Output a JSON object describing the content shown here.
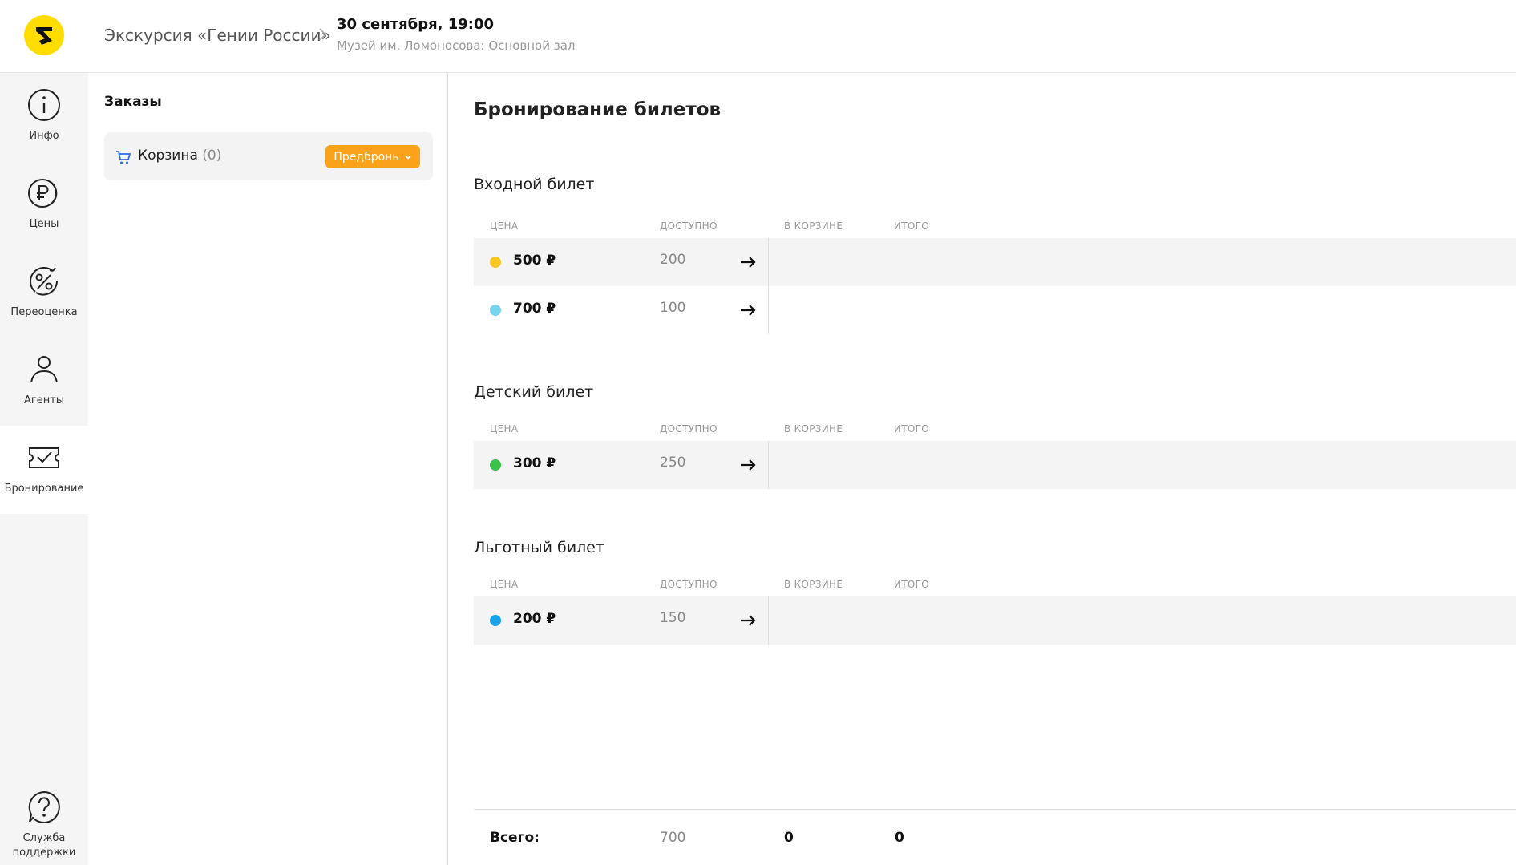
{
  "header": {
    "event_title": "Экскурсия «Гении России»",
    "date": "30 сентября, 19:00",
    "place": "Музей им. Ломоносова: Основной зал"
  },
  "rail": [
    {
      "label": "Инфо",
      "icon": "info-icon"
    },
    {
      "label": "Цены",
      "icon": "ruble-icon"
    },
    {
      "label": "Переоценка",
      "icon": "percent-icon"
    },
    {
      "label": "Агенты",
      "icon": "person-icon"
    },
    {
      "label": "Бронирование",
      "icon": "ticket-check-icon",
      "active": true
    },
    {
      "label": "Служба поддержки",
      "icon": "help-bubble-icon"
    }
  ],
  "orders": {
    "title": "Заказы",
    "cart_label": "Корзина",
    "cart_count": "(0)",
    "prebook_label": "Предбронь"
  },
  "main": {
    "title": "Бронирование билетов",
    "columns": {
      "price": "ЦЕНА",
      "available": "ДОСТУПНО",
      "in_cart": "В КОРЗИНЕ",
      "total": "ИТОГО"
    },
    "sections": [
      {
        "title": "Входной билет",
        "rows": [
          {
            "price": "500 ₽",
            "available": "200",
            "color": "#f7c623"
          },
          {
            "price": "700 ₽",
            "available": "100",
            "color": "#78d4ec"
          }
        ]
      },
      {
        "title": "Детский билет",
        "rows": [
          {
            "price": "300 ₽",
            "available": "250",
            "color": "#3cc24a"
          }
        ]
      },
      {
        "title": "Льготный билет",
        "rows": [
          {
            "price": "200 ₽",
            "available": "150",
            "color": "#1aa1e6"
          }
        ]
      }
    ],
    "totals": {
      "label": "Всего:",
      "available": "700",
      "in_cart": "0",
      "sum": "0"
    }
  }
}
